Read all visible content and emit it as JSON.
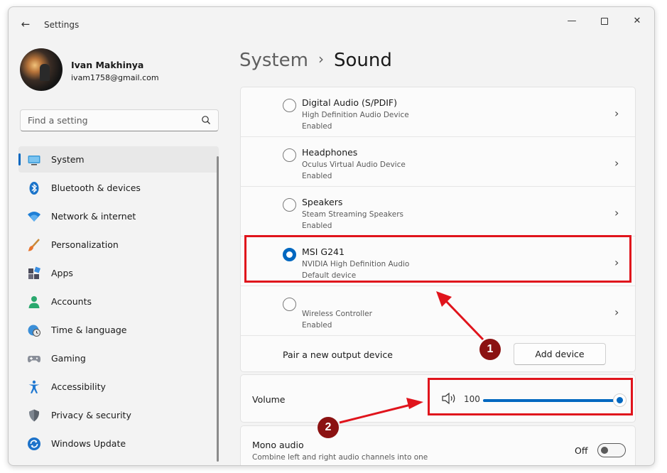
{
  "window": {
    "title": "Settings",
    "back_icon": "arrow-left-icon",
    "controls": {
      "minimize": "—",
      "close": "✕"
    }
  },
  "user": {
    "name": "Ivan Makhinya",
    "email": "ivam1758@gmail.com"
  },
  "search": {
    "placeholder": "Find a setting"
  },
  "nav": {
    "items": [
      {
        "label": "System",
        "icon": "system-monitor-icon",
        "active": true
      },
      {
        "label": "Bluetooth & devices",
        "icon": "bluetooth-icon"
      },
      {
        "label": "Network & internet",
        "icon": "wifi-icon"
      },
      {
        "label": "Personalization",
        "icon": "brush-icon"
      },
      {
        "label": "Apps",
        "icon": "apps-icon"
      },
      {
        "label": "Accounts",
        "icon": "person-icon"
      },
      {
        "label": "Time & language",
        "icon": "globe-clock-icon"
      },
      {
        "label": "Gaming",
        "icon": "gamepad-icon"
      },
      {
        "label": "Accessibility",
        "icon": "accessibility-icon"
      },
      {
        "label": "Privacy & security",
        "icon": "shield-icon"
      },
      {
        "label": "Windows Update",
        "icon": "update-icon"
      }
    ]
  },
  "breadcrumb": {
    "parent": "System",
    "separator": "›",
    "current": "Sound"
  },
  "output_devices": [
    {
      "name": "Digital Audio (S/PDIF)",
      "description": "High Definition Audio Device",
      "status": "Enabled",
      "selected": false
    },
    {
      "name": "Headphones",
      "description": "Oculus Virtual Audio Device",
      "status": "Enabled",
      "selected": false
    },
    {
      "name": "Speakers",
      "description": "Steam Streaming Speakers",
      "status": "Enabled",
      "selected": false
    },
    {
      "name": "MSI G241",
      "description": "NVIDIA High Definition Audio",
      "status": "Default device",
      "selected": true
    },
    {
      "name": "",
      "description": "Wireless Controller",
      "status": "Enabled",
      "selected": false
    }
  ],
  "pair": {
    "label": "Pair a new output device",
    "button": "Add device"
  },
  "volume": {
    "label": "Volume",
    "value": "100",
    "level_percent": 100
  },
  "mono": {
    "label": "Mono audio",
    "description": "Combine left and right audio channels into one",
    "state": "Off"
  },
  "annotations": {
    "badge_1": "1",
    "badge_2": "2",
    "color": "#e0141c",
    "badge_color": "#8b1212"
  },
  "colors": {
    "accent": "#0067c0",
    "window_bg": "#f3f3f3",
    "card_bg": "#fbfbfb"
  }
}
